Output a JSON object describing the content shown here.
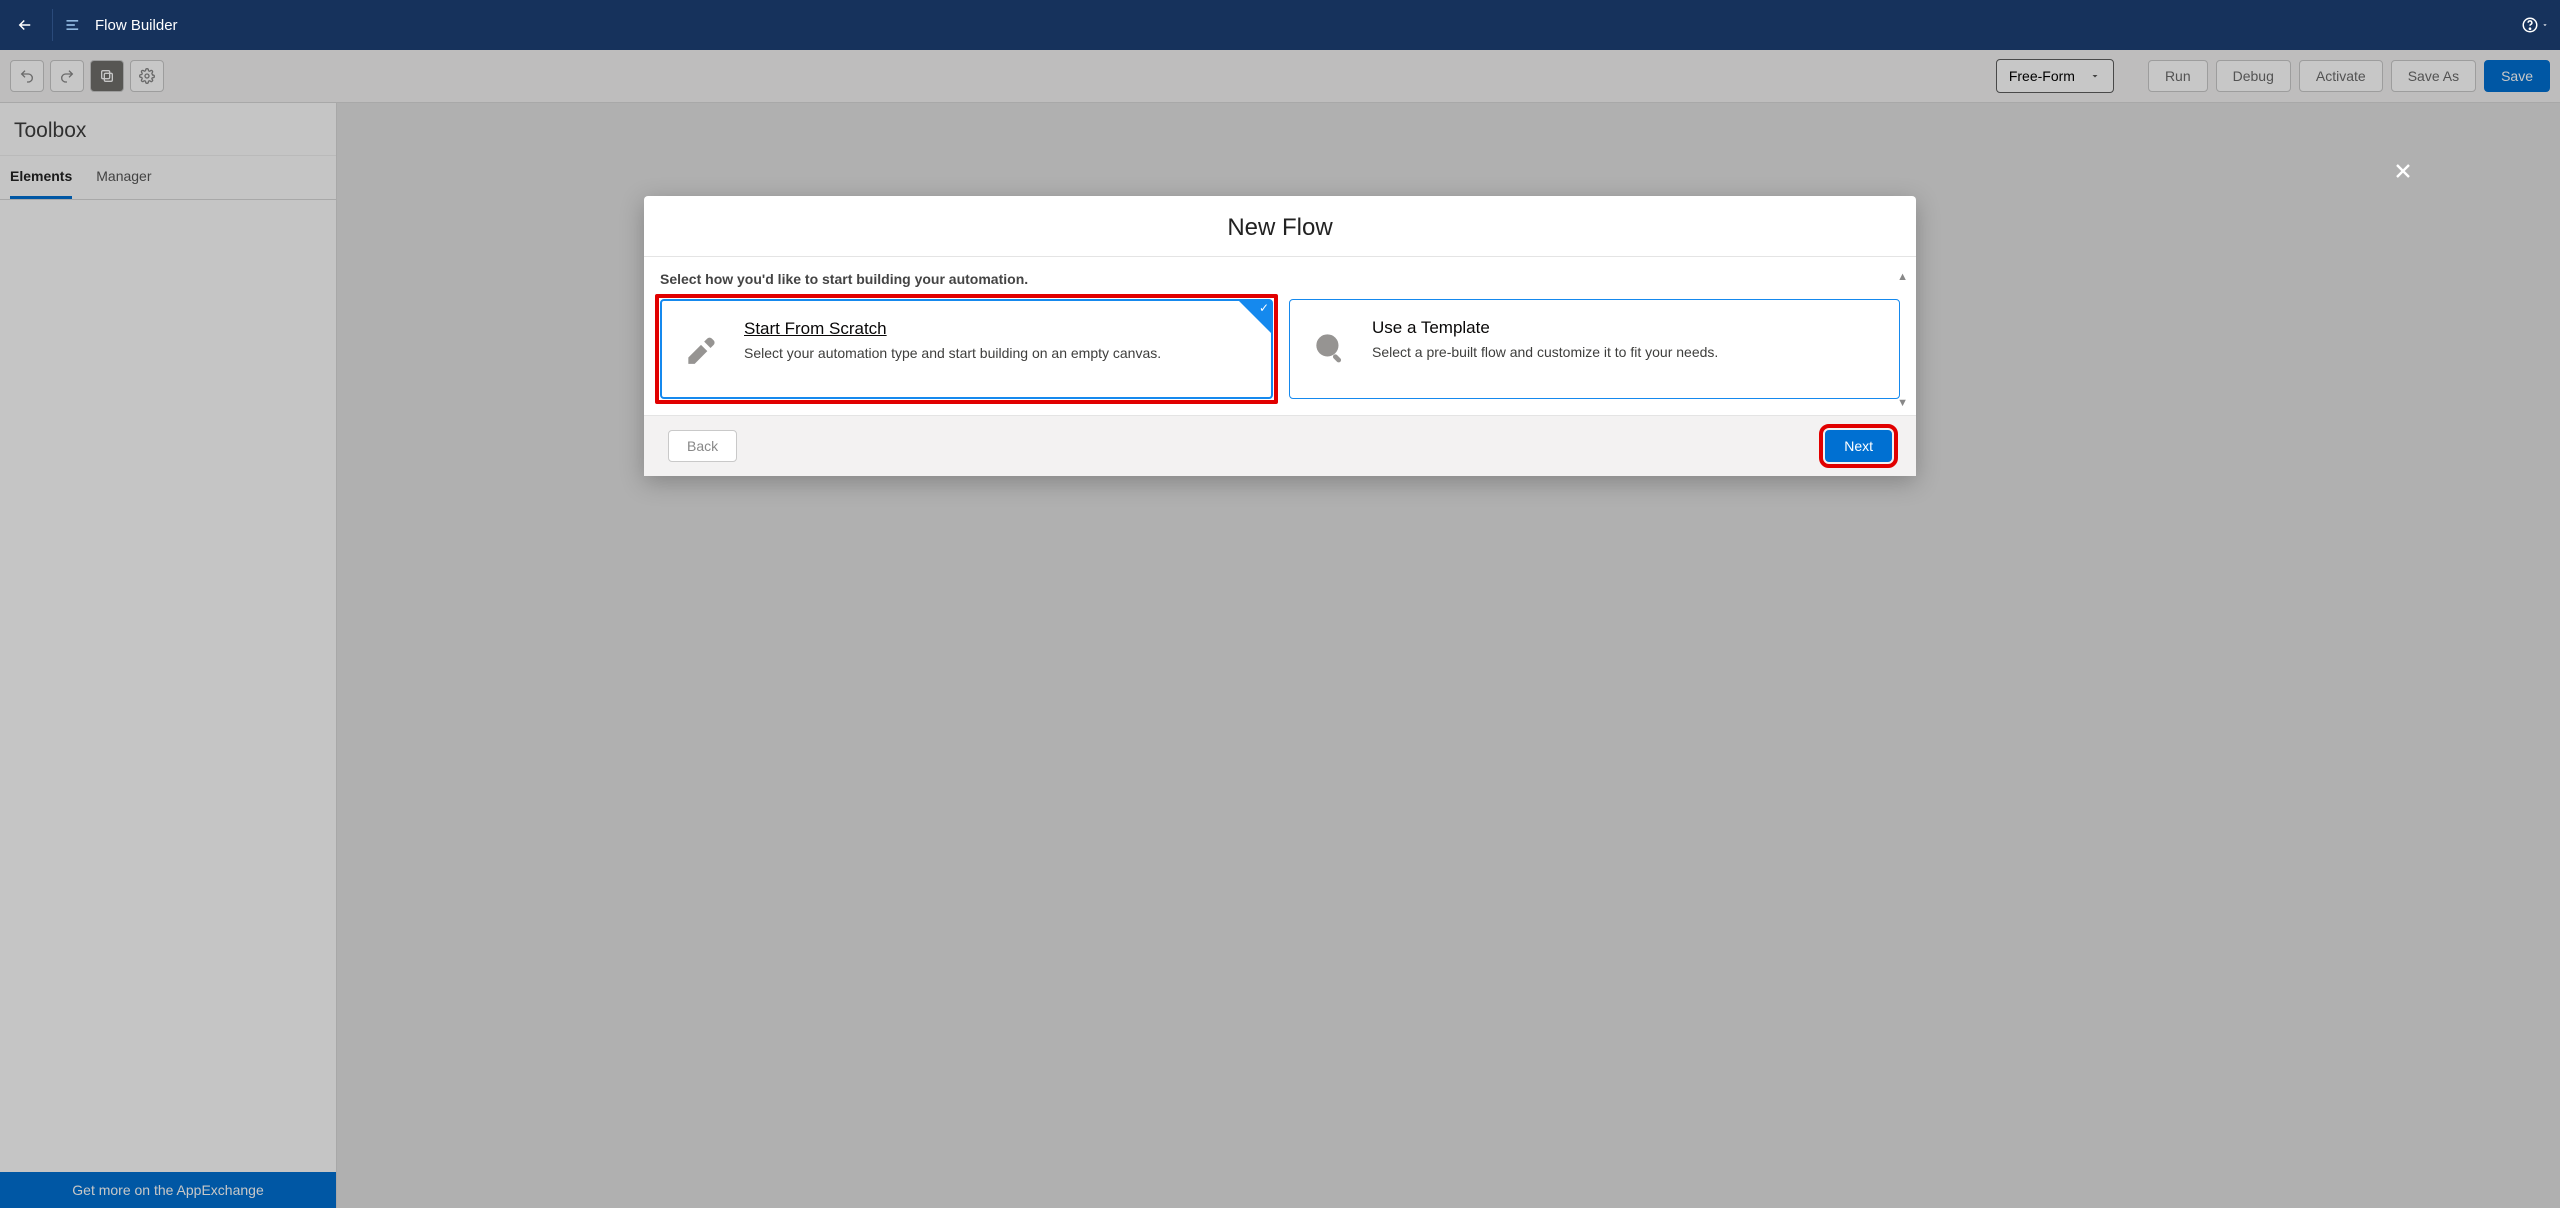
{
  "header": {
    "title": "Flow Builder"
  },
  "toolbar": {
    "layout_mode": "Free-Form",
    "actions": {
      "run": "Run",
      "debug": "Debug",
      "activate": "Activate",
      "save_as": "Save As",
      "save": "Save"
    }
  },
  "sidebar": {
    "title": "Toolbox",
    "tabs": {
      "elements": "Elements",
      "manager": "Manager"
    },
    "footer": "Get more on the AppExchange"
  },
  "modal": {
    "title": "New Flow",
    "instruction": "Select how you'd like to start building your automation.",
    "options": [
      {
        "title": "Start From Scratch",
        "desc": "Select your automation type and start building on an empty canvas.",
        "selected": true
      },
      {
        "title": "Use a Template",
        "desc": "Select a pre-built flow and customize it to fit your needs.",
        "selected": false
      }
    ],
    "buttons": {
      "back": "Back",
      "next": "Next"
    }
  }
}
